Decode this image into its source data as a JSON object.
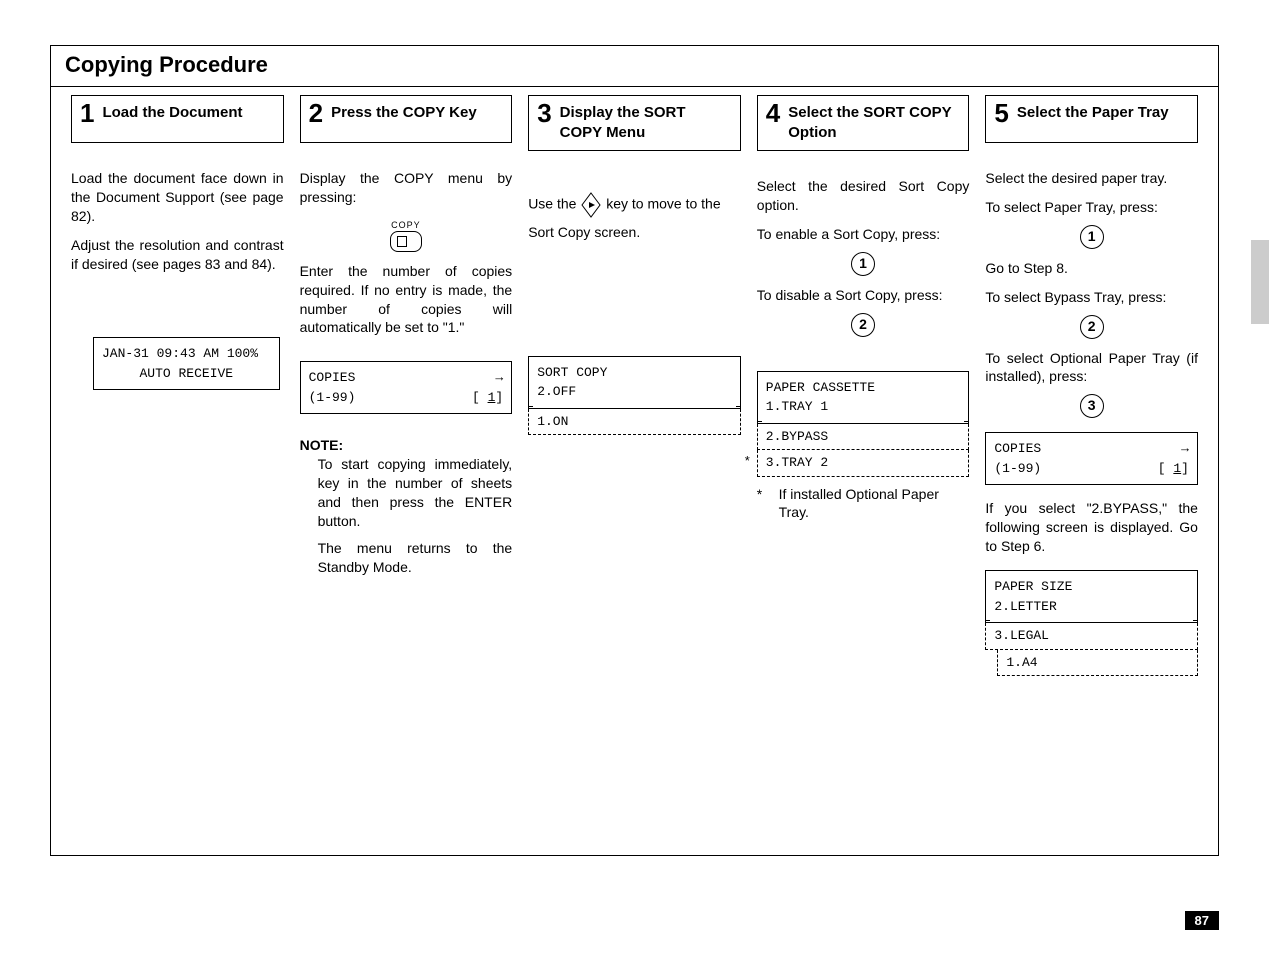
{
  "page_number": "87",
  "section_title": "Copying  Procedure",
  "steps": [
    {
      "num": "1",
      "title": "Load the Document",
      "para1": "Load the document face down in the Document Support (see page 82).",
      "para2": "Adjust the resolution and contrast if desired (see pages 83 and 84).",
      "lcd": {
        "line1_left": "JAN-31 09:43 AM 100%",
        "line2_center": "AUTO RECEIVE"
      }
    },
    {
      "num": "2",
      "title": "Press the COPY Key",
      "para1": "Display the COPY menu by pressing:",
      "copy_label": "COPY",
      "para2": "Enter the number of copies required. If no entry is made, the number of copies will automatically be set to \"1.\"",
      "lcd": {
        "line1_left": "COPIES",
        "line1_right": "→",
        "line2_left": "(1-99)",
        "line2_right": "[ 1]"
      },
      "note_label": "NOTE:",
      "note_p1": "To start copying immediately, key in the number of sheets and then press the ENTER button.",
      "note_p2": "The menu returns to the Standby Mode."
    },
    {
      "num": "3",
      "title": "Display the SORT COPY Menu",
      "para1a": "Use the ",
      "para1b": " key to move to the",
      "para2": "Sort Copy screen.",
      "lcd": {
        "line1": "SORT COPY",
        "line2": "2.OFF",
        "ext1": "1.ON"
      }
    },
    {
      "num": "4",
      "title": "Select the SORT COPY Option",
      "para1": "Select the desired Sort Copy option.",
      "para2": "To enable a Sort Copy, press:",
      "key1": "1",
      "para3": "To disable a Sort Copy, press:",
      "key2": "2",
      "lcd": {
        "line1": "PAPER CASSETTE",
        "line2": "1.TRAY 1",
        "ext1": "2.BYPASS",
        "ext2": "3.TRAY 2"
      },
      "footnote_star": "*",
      "footnote": "If installed Optional Paper Tray."
    },
    {
      "num": "5",
      "title": "Select the Paper Tray",
      "para1": "Select the desired paper tray.",
      "para2": "To select Paper Tray, press:",
      "key1": "1",
      "para3": "Go to Step 8.",
      "para4": "To select Bypass Tray, press:",
      "key2": "2",
      "para5": "To select Optional Paper Tray (if installed), press:",
      "key3": "3",
      "lcd1": {
        "line1_left": "COPIES",
        "line1_right": "→",
        "line2_left": "(1-99)",
        "line2_right": "[ 1]"
      },
      "para6": "If you select \"2.BYPASS,\" the following screen is displayed. Go to Step 6.",
      "lcd2": {
        "line1": "PAPER SIZE",
        "line2": "2.LETTER",
        "ext1": "3.LEGAL",
        "ext2": "1.A4"
      }
    }
  ]
}
